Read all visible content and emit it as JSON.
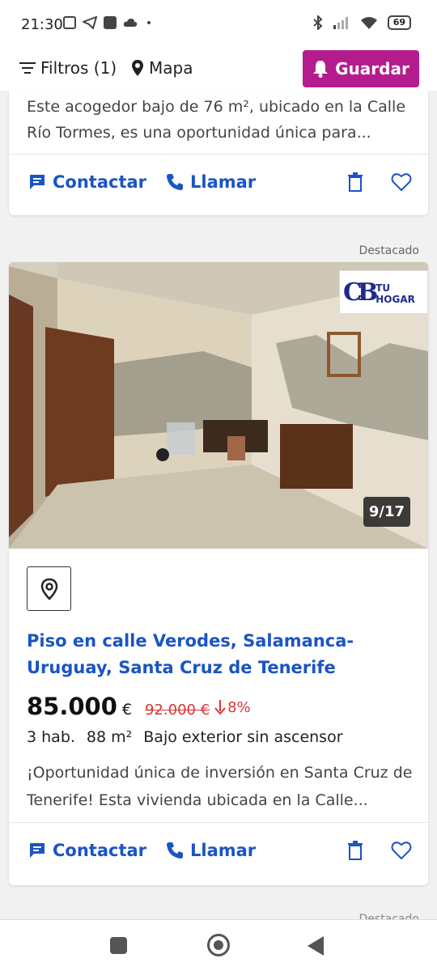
{
  "status_bar": {
    "time": "21:30",
    "battery": "69"
  },
  "toolbar": {
    "filters_label": "Filtros (1)",
    "map_label": "Mapa",
    "save_label": "Guardar"
  },
  "card1": {
    "description": "Este acogedor bajo de 76 m², ubicado en la Calle Río Tormes, es una oportunidad única para...",
    "contact_label": "Contactar",
    "call_label": "Llamar"
  },
  "featured_label": "Destacado",
  "card2": {
    "image_counter": "9/17",
    "logo_text": "TU HOGAR",
    "logo_initials": "CB",
    "title": "Piso en calle Verodes, Salamanca-Uruguay, Santa Cruz de Tenerife",
    "price": "85.000",
    "currency": "€",
    "old_price": "92.000 €",
    "price_drop": "8%",
    "rooms": "3 hab.",
    "area": "88 m²",
    "floor": "Bajo exterior sin ascensor",
    "description": "¡Oportunidad única de inversión en Santa Cruz de Tenerife! Esta vivienda ubicada en la Calle...",
    "contact_label": "Contactar",
    "call_label": "Llamar"
  },
  "next_featured_label": "Destacado",
  "colors": {
    "brand_magenta": "#b41c8e",
    "link_blue": "#1a55c2",
    "price_drop_red": "#d33333"
  }
}
